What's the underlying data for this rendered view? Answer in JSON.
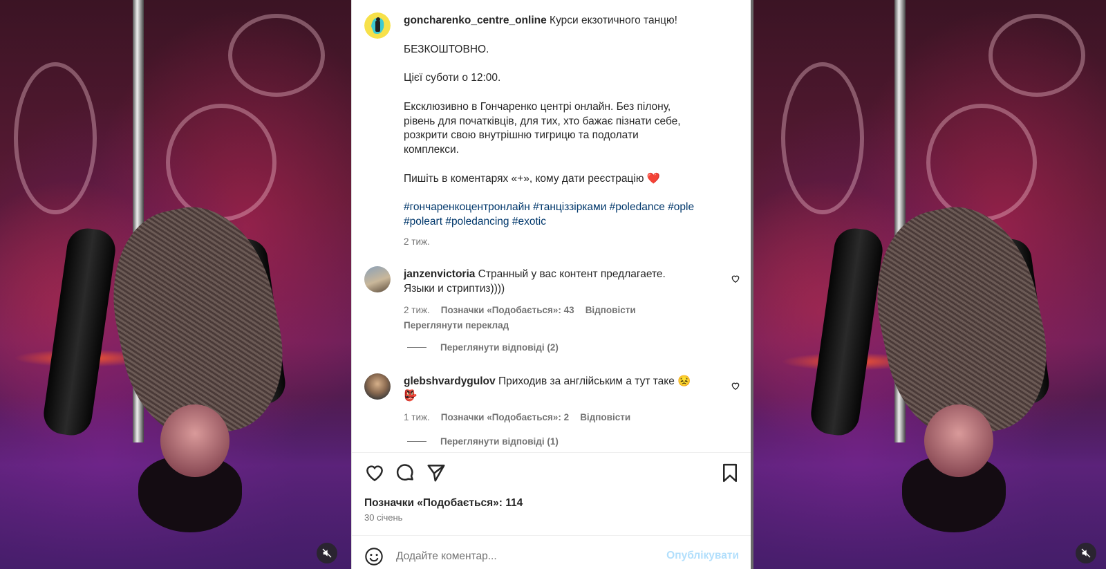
{
  "post": {
    "username": "goncharenko_centre_online",
    "caption_first": " Курси екзотичного танцю!",
    "caption_paragraphs": [
      "БЕЗКОШТОВНО.",
      "Цієї суботи о 12:00.",
      "Ексклюзивно в Гончаренко центрі онлайн. Без пілону,\nрівень для початківців, для тих, хто бажає пізнати себе,\nрозкрити свою внутрішню тигрицю та подолати\nкомплекси.",
      "Пишіть в коментарях «+», кому дати реєстрацію ❤️"
    ],
    "hashtags": "#гончаренкоцентронлайн #танціззірками #poledance #ople\n#poleart #poledancing #exotic",
    "time": "2 тиж.",
    "likes_label": "Позначки «Подобається»: 114",
    "date": "30 січень"
  },
  "comments": [
    {
      "username": "janzenvictoria",
      "text": " Странный у вас контент предлагаете.\nЯзыки и стриптиз))))",
      "time": "2 тиж.",
      "likes": "Позначки «Подобається»: 43",
      "reply": "Відповісти",
      "translate": "Переглянути переклад",
      "view_replies": "Переглянути відповіді (2)"
    },
    {
      "username": "glebshvardygulov",
      "text": " Приходив за англійським а тут таке 😣\n👺",
      "time": "1 тиж.",
      "likes": "Позначки «Подобається»: 2",
      "reply": "Відповісти",
      "view_replies": "Переглянути відповіді (1)"
    }
  ],
  "comment_box": {
    "placeholder": "Додайте коментар...",
    "publish_label": "Опублікувати"
  },
  "icons": {
    "like": "heart-icon",
    "comment": "comment-icon",
    "share": "paper-plane-icon",
    "save": "bookmark-icon",
    "emoji": "emoji-icon",
    "mute": "speaker-muted-icon"
  },
  "colors": {
    "link": "#00376b",
    "muted": "#737373",
    "publish_disabled": "#b2dffc",
    "text": "#262626"
  }
}
